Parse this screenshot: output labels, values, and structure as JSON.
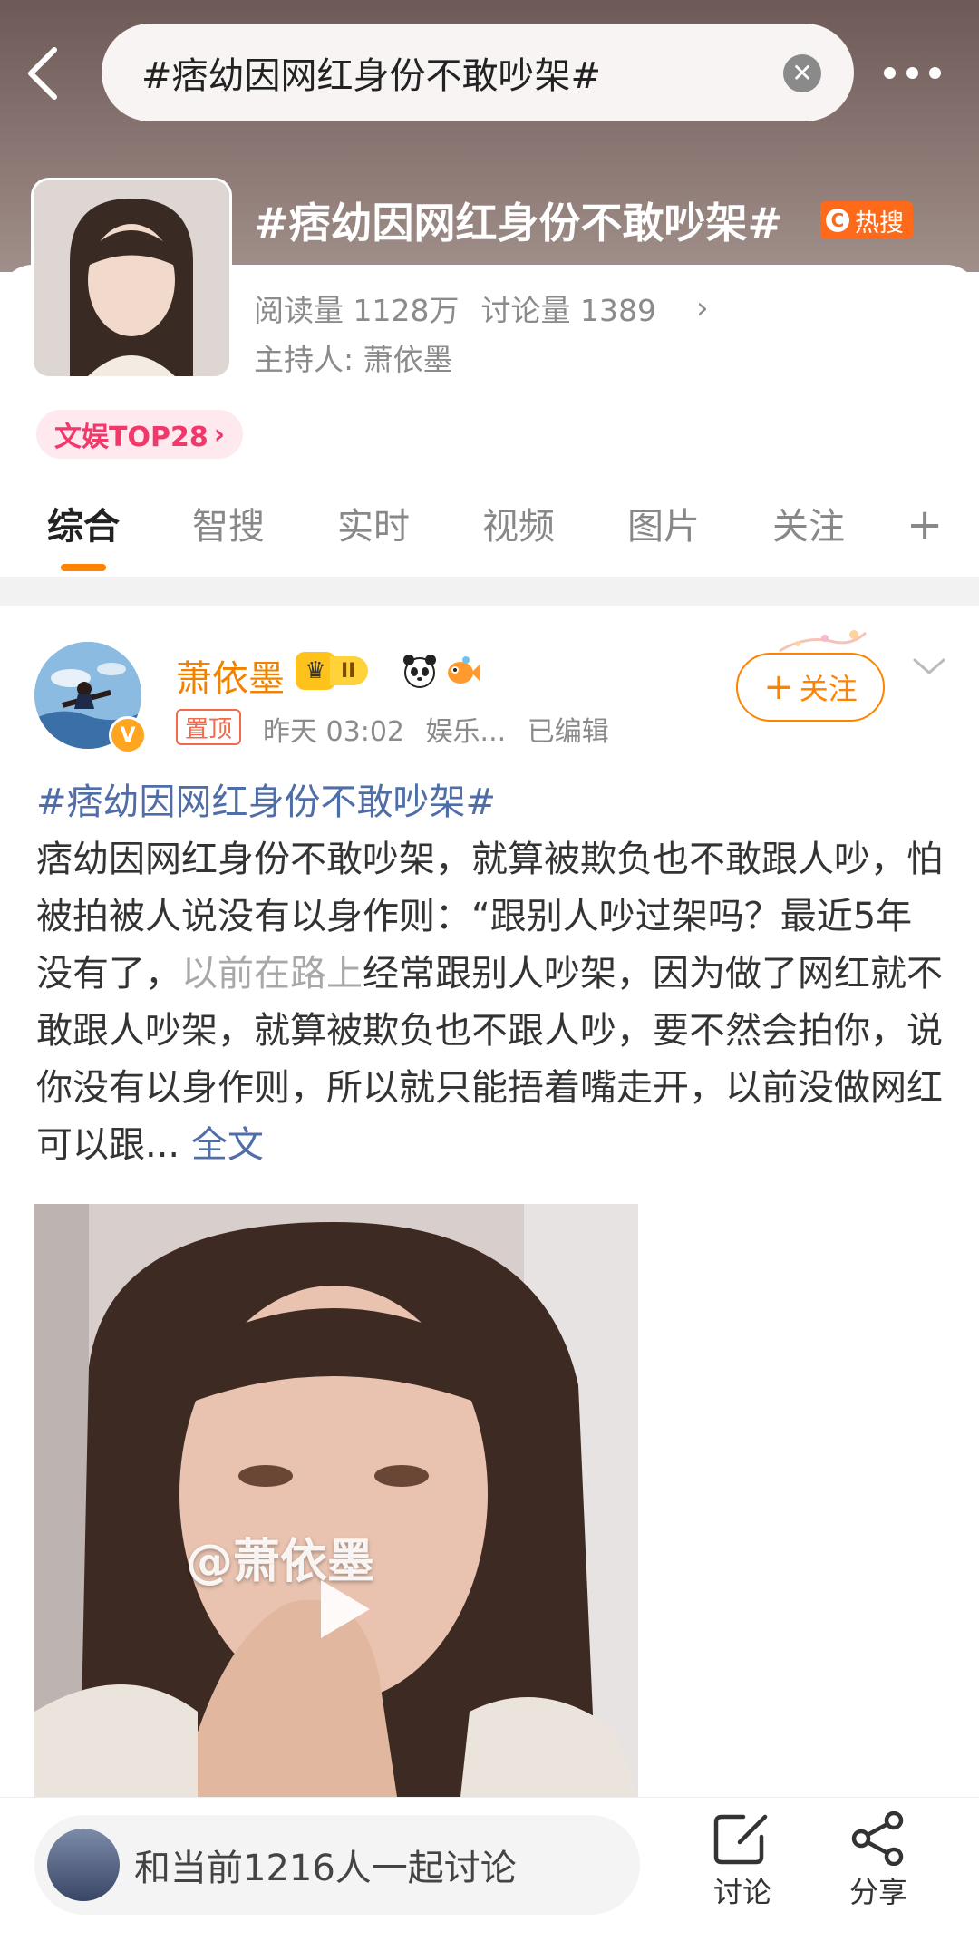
{
  "search": {
    "query": "#痞幼因网红身份不敢吵架#"
  },
  "topic": {
    "title": "#痞幼因网红身份不敢吵架#",
    "hot_label": "热搜",
    "reads_label": "阅读量",
    "reads_value": "1128万",
    "discuss_label": "讨论量",
    "discuss_value": "1389",
    "host_label": "主持人:",
    "host_name": "萧依墨",
    "rank_label": "文娱TOP28"
  },
  "tabs": [
    {
      "label": "综合"
    },
    {
      "label": "智搜"
    },
    {
      "label": "实时"
    },
    {
      "label": "视频"
    },
    {
      "label": "图片"
    },
    {
      "label": "关注"
    }
  ],
  "post": {
    "author": "萧依墨",
    "vip_level": "II",
    "pinned_label": "置顶",
    "time": "昨天 03:02",
    "source": "娱乐...",
    "edited_label": "已编辑",
    "follow_label": "关注",
    "hashtag": "#痞幼因网红身份不敢吵架#",
    "body_part1": "痞幼因网红身份不敢吵架，就算被欺负也不敢跟人吵，怕被拍被人说没有以身作则：“跟别人吵过架吗？最近5年没有了，",
    "body_watermark": "以前在路上",
    "body_part2": "经常跟别人吵架，因为做了网红就不敢跟人吵架，就算被欺负也不跟人吵，要不然会拍你，说你没有以身作则，所以就只能捂着嘴走开，以前没做网红可以跟...",
    "full_text_label": "全文",
    "video_watermark": "@萧依墨"
  },
  "bottom": {
    "discuss_prompt": "和当前1216人一起讨论",
    "comment_label": "讨论",
    "share_label": "分享"
  },
  "colors": {
    "accent": "#ff8200",
    "hot_badge": "#ff6a1a",
    "link": "#4f6ea8",
    "rank_pink": "#f0386b"
  }
}
